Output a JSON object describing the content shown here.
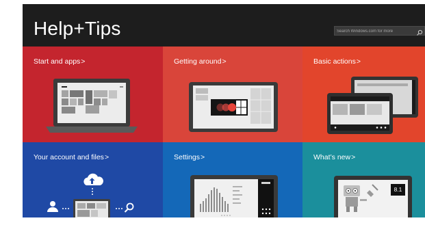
{
  "header": {
    "title": "Help+Tips",
    "search": {
      "placeholder": "Search Windows.com for more",
      "icon": "search-icon"
    }
  },
  "colors": {
    "header_bg": "#1d1d1d",
    "start_and_apps": "#c4252e",
    "getting_around": "#d9453a",
    "basic_actions": "#e2452c",
    "your_account_and_files": "#1f49a5",
    "settings": "#1468b8",
    "whats_new": "#1b8f9c"
  },
  "tiles": [
    {
      "label": "Start and apps",
      "chevron": ">"
    },
    {
      "label": "Getting around",
      "chevron": ">"
    },
    {
      "label": "Basic actions",
      "chevron": ">"
    },
    {
      "label": "Your account and files",
      "chevron": ">"
    },
    {
      "label": "Settings",
      "chevron": ">"
    },
    {
      "label": "What’s new",
      "chevron": ">",
      "badge": "8.1"
    }
  ]
}
